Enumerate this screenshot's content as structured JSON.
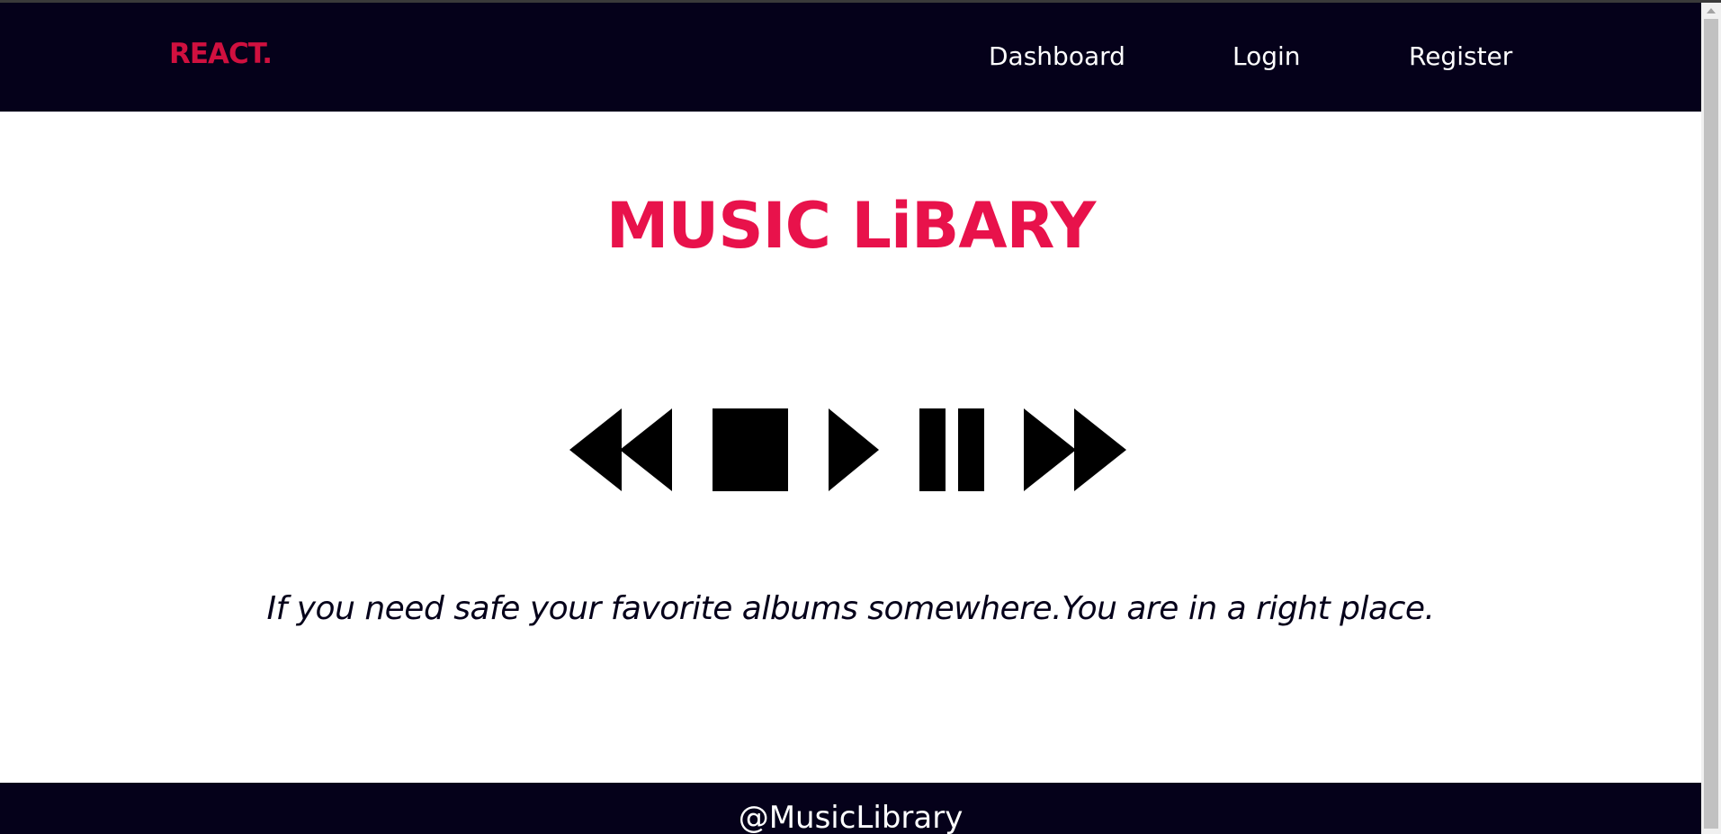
{
  "navbar": {
    "brand": "REACT.",
    "links": [
      "Dashboard",
      "Login",
      "Register"
    ]
  },
  "main": {
    "title": "MUSIC LiBARY",
    "controls": [
      "rewind-icon",
      "stop-icon",
      "play-icon",
      "pause-icon",
      "fast-forward-icon"
    ],
    "tagline": "If you need safe your favorite albums somewhere.You are in a right place."
  },
  "footer": {
    "text": "@MusicLibrary"
  },
  "colors": {
    "nav_bg": "#05011a",
    "brand": "#d0103f",
    "title": "#e8124b",
    "text_dark": "#05011a",
    "icon": "#000000"
  }
}
